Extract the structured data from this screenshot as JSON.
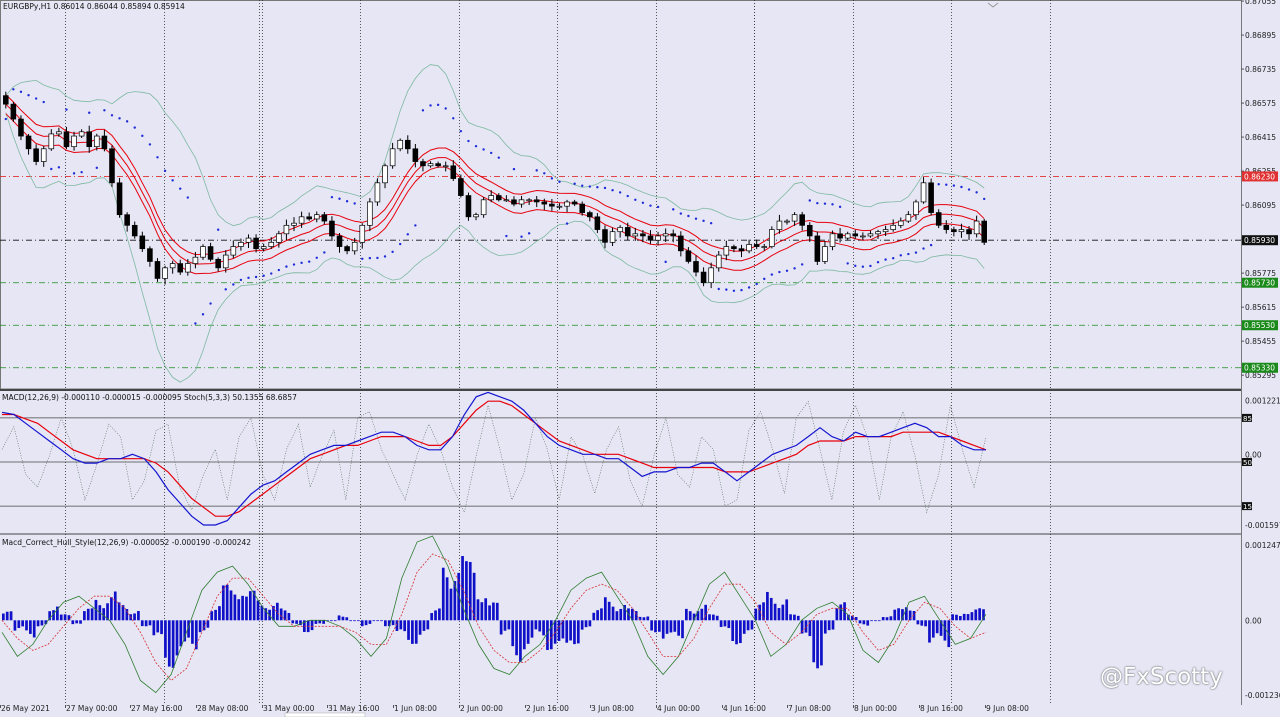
{
  "header": {
    "symbol_line": "EURGBPy,H1  0.86014 0.86044 0.85894 0.85914"
  },
  "subwindow1": {
    "title": "MACD(12,26,9) -0.000110 -0.000015 -0.000095  Stoch(5,3,3) 50.1355 68.6857"
  },
  "subwindow2": {
    "title": "Macd_Correct_Hull_Style(12,26,9) -0.000052 -0.000190 -0.000242"
  },
  "watermark": "@FxScotty",
  "colors": {
    "background": "#e6e6f5",
    "bull_candle": "#ffffff",
    "bear_candle": "#000000",
    "ma": "#e8000b",
    "macd_main": "#1515d0",
    "macd_signal": "#e8000b",
    "histogram": "#1010c8",
    "line_red": "#d83030",
    "line_green": "#2f7d2f",
    "psar": "#1e2bd8"
  },
  "chart_data": [
    {
      "type": "candlestick",
      "title": "EURGBPy,H1",
      "ohlc_header": [
        "0.86014",
        "0.86044",
        "0.85894",
        "0.85914"
      ],
      "x_tick_labels": [
        "26 May 2021",
        "27 May 00:00",
        "27 May 16:00",
        "28 May 08:00",
        "31 May 00:00",
        "31 May 16:00",
        "1 Jun 08:00",
        "2 Jun 00:00",
        "2 Jun 16:00",
        "3 Jun 08:00",
        "4 Jun 00:00",
        "4 Jun 16:00",
        "7 Jun 08:00",
        "8 Jun 00:00",
        "8 Jun 16:00",
        "9 Jun 08:00"
      ],
      "y_ticks": [
        "0.87055",
        "0.86895",
        "0.86735",
        "0.86575",
        "0.86415",
        "0.86255",
        "0.86095",
        "0.85935",
        "0.85775",
        "0.85615",
        "0.85455",
        "0.85295"
      ],
      "ylim": [
        0.8523,
        0.8706
      ],
      "horizontal_levels": [
        {
          "label": "0.86230",
          "value": 0.8623,
          "color": "#e03030"
        },
        {
          "label": "0.85930",
          "value": 0.8593,
          "color": "#111111"
        },
        {
          "label": "0.85730",
          "value": 0.8573,
          "color": "#1a8a1a"
        },
        {
          "label": "0.85530",
          "value": 0.8553,
          "color": "#1a8a1a"
        },
        {
          "label": "0.85330",
          "value": 0.8533,
          "color": "#1a8a1a"
        }
      ],
      "close_series": [
        0.8657,
        0.865,
        0.8642,
        0.8636,
        0.863,
        0.8636,
        0.8643,
        0.8644,
        0.8637,
        0.8642,
        0.8644,
        0.8637,
        0.8642,
        0.8636,
        0.862,
        0.8605,
        0.86,
        0.8595,
        0.8589,
        0.8583,
        0.8575,
        0.858,
        0.8582,
        0.8578,
        0.8582,
        0.8585,
        0.859,
        0.8584,
        0.858,
        0.8586,
        0.859,
        0.8592,
        0.8594,
        0.8589,
        0.859,
        0.8592,
        0.8596,
        0.86,
        0.8601,
        0.8604,
        0.8603,
        0.8605,
        0.8602,
        0.8595,
        0.859,
        0.8588,
        0.8592,
        0.86,
        0.8611,
        0.862,
        0.8628,
        0.8636,
        0.864,
        0.8636,
        0.863,
        0.8628,
        0.8629,
        0.8628,
        0.8628,
        0.8622,
        0.8614,
        0.8604,
        0.8605,
        0.8612,
        0.8614,
        0.8612,
        0.8612,
        0.861,
        0.8612,
        0.8612,
        0.8611,
        0.861,
        0.8609,
        0.8609,
        0.8611,
        0.861,
        0.8606,
        0.8604,
        0.8598,
        0.8592,
        0.8597,
        0.8599,
        0.8595,
        0.8596,
        0.8595,
        0.8593,
        0.8595,
        0.8596,
        0.8595,
        0.8588,
        0.8583,
        0.8578,
        0.8573,
        0.858,
        0.8586,
        0.859,
        0.8589,
        0.8588,
        0.8591,
        0.859,
        0.859,
        0.8598,
        0.8602,
        0.8602,
        0.8605,
        0.86,
        0.8595,
        0.8583,
        0.859,
        0.8596,
        0.8594,
        0.8596,
        0.8595,
        0.8595,
        0.8596,
        0.8597,
        0.8598,
        0.86,
        0.8602,
        0.8605,
        0.8611,
        0.862,
        0.8606,
        0.86,
        0.8598,
        0.8597,
        0.8598,
        0.8596,
        0.8602,
        0.8592
      ]
    },
    {
      "type": "line",
      "title": "MACD(12,26,9) -0.000110 -0.000015 -0.000095  Stoch(5,3,3) 50.1355 68.6857",
      "y_tick_labels": [
        "0.001221",
        "0.00",
        "-0.001597"
      ],
      "stoch_levels": [
        "85",
        "50",
        "15"
      ],
      "series": [
        {
          "name": "MACD",
          "values": [
            0.00095,
            0.0009,
            0.0007,
            0.0005,
            0.0003,
            0.0001,
            -0.0001,
            -0.0002,
            -0.0002,
            -0.0001,
            -0.0001,
            0.0,
            -0.0001,
            -0.0004,
            -0.0008,
            -0.0011,
            -0.0014,
            -0.0016,
            -0.0016,
            -0.0015,
            -0.0012,
            -0.0009,
            -0.0007,
            -0.0006,
            -0.0004,
            -0.0002,
            0.0,
            0.0001,
            0.0002,
            0.0002,
            0.0003,
            0.0004,
            0.0005,
            0.0005,
            0.0004,
            0.0002,
            0.0001,
            0.0001,
            0.0004,
            0.0009,
            0.0013,
            0.0014,
            0.0013,
            0.0012,
            0.001,
            0.0007,
            0.0004,
            0.0002,
            0.0001,
            0.0,
            0.0,
            -0.0001,
            -0.0001,
            -0.0003,
            -0.0005,
            -0.0004,
            -0.0004,
            -0.0003,
            -0.0003,
            -0.0002,
            -0.0002,
            -0.0004,
            -0.0006,
            -0.0004,
            -0.0002,
            0.0,
            0.0001,
            0.0002,
            0.0004,
            0.0006,
            0.0004,
            0.0003,
            0.0005,
            0.0004,
            0.0004,
            0.0005,
            0.0006,
            0.0007,
            0.0006,
            0.0004,
            0.0004,
            0.0002,
            0.0001,
            0.0001
          ]
        },
        {
          "name": "Signal",
          "values": [
            0.0009,
            0.0009,
            0.0008,
            0.0007,
            0.0005,
            0.0003,
            0.0001,
            0.0,
            -0.0001,
            -0.0001,
            -0.0001,
            -0.0001,
            -0.0001,
            -0.0002,
            -0.0004,
            -0.0007,
            -0.001,
            -0.0012,
            -0.0014,
            -0.0014,
            -0.0013,
            -0.0011,
            -0.0009,
            -0.0007,
            -0.0005,
            -0.0003,
            -0.0001,
            0.0,
            0.0001,
            0.0002,
            0.0002,
            0.0003,
            0.0004,
            0.0004,
            0.0004,
            0.0003,
            0.0002,
            0.0002,
            0.0004,
            0.0007,
            0.001,
            0.0012,
            0.0012,
            0.0011,
            0.0009,
            0.0007,
            0.0005,
            0.0003,
            0.0002,
            0.0001,
            0.0,
            0.0,
            0.0,
            -0.0001,
            -0.0002,
            -0.0003,
            -0.0003,
            -0.0003,
            -0.0003,
            -0.0003,
            -0.0003,
            -0.0004,
            -0.0004,
            -0.0004,
            -0.0003,
            -0.0002,
            -0.0001,
            0.0,
            0.0002,
            0.0003,
            0.0003,
            0.0003,
            0.0004,
            0.0004,
            0.0004,
            0.0004,
            0.0005,
            0.0005,
            0.0005,
            0.0005,
            0.0004,
            0.0003,
            0.0002,
            0.0001
          ]
        },
        {
          "name": "Stoch",
          "values": [
            60,
            78,
            40,
            30,
            55,
            85,
            60,
            20,
            48,
            80,
            70,
            20,
            35,
            75,
            80,
            30,
            12,
            40,
            60,
            20,
            70,
            85,
            40,
            20,
            60,
            80,
            30,
            55,
            75,
            20,
            85,
            90,
            60,
            40,
            20,
            55,
            80,
            60,
            30,
            10,
            55,
            95,
            60,
            20,
            40,
            85,
            60,
            20,
            70,
            55,
            25,
            60,
            78,
            35,
            15,
            55,
            85,
            40,
            30,
            70,
            60,
            15,
            20,
            75,
            90,
            60,
            25,
            85,
            98,
            60,
            20,
            75,
            95,
            70,
            20,
            70,
            90,
            55,
            10,
            40,
            95,
            60,
            30,
            70
          ]
        }
      ]
    },
    {
      "type": "bar",
      "title": "Macd_Correct_Hull_Style(12,26,9) -0.000052 -0.000190 -0.000242",
      "y_tick_labels": [
        "0.001247",
        "0.00",
        "-0.001236"
      ],
      "series": [
        {
          "name": "Histogram",
          "values": [
            0.00015,
            -0.0002,
            -0.0003,
            -0.0001,
            0.0003,
            0.0001,
            -0.0001,
            0.0002,
            0.0004,
            0.0005,
            0.0003,
            0.0002,
            -0.0001,
            -0.0004,
            -0.0008,
            -0.0007,
            -0.0005,
            -0.0002,
            0.0003,
            0.0006,
            0.0007,
            0.0005,
            0.0004,
            0.0003,
            0.0002,
            -0.0001,
            -0.0002,
            -0.0001,
            0.0,
            0.0001,
            0.0,
            -0.0001,
            0.0,
            -0.0001,
            -0.0003,
            -0.0004,
            -0.0003,
            0.0002,
            0.0009,
            0.0013,
            0.001,
            0.0006,
            0.0003,
            -0.0003,
            -0.0007,
            -0.0005,
            -0.0003,
            -0.0005,
            -0.0006,
            -0.0004,
            -0.0002,
            0.0002,
            0.0004,
            0.0003,
            0.0002,
            0.0001,
            -0.0002,
            -0.0004,
            -0.0003,
            0.0002,
            0.0003,
            0.0001,
            -0.0002,
            -0.0004,
            -0.0003,
            0.0003,
            0.0005,
            0.0004,
            0.0001,
            -0.0004,
            -0.0008,
            -0.0003,
            0.0003,
            0.0001,
            -0.0001,
            0.0,
            0.0001,
            0.0002,
            0.0003,
            -0.0001,
            -0.0004,
            -0.0005,
            0.0001,
            0.0002,
            0.0002
          ]
        },
        {
          "name": "Line 1",
          "values": [
            -0.0002,
            -0.0006,
            -0.0004,
            0.0,
            0.0003,
            0.0004,
            0.0002,
            0.0,
            -0.0004,
            -0.001,
            -0.0012,
            -0.0009,
            -0.0002,
            0.0005,
            0.0008,
            0.0009,
            0.0006,
            0.0002,
            -0.0001,
            -0.0001,
            0.0,
            0.0,
            -0.0001,
            -0.0003,
            -0.0006,
            -0.0003,
            0.0007,
            0.0013,
            0.0014,
            0.0009,
            0.0002,
            -0.0004,
            -0.0008,
            -0.0009,
            -0.0006,
            -0.0004,
            0.0,
            0.0005,
            0.0007,
            0.0008,
            0.0004,
            0.0,
            -0.0006,
            -0.0009,
            -0.0006,
            0.0,
            0.0006,
            0.0008,
            0.0004,
            0.0,
            -0.0006,
            -0.0004,
            0.0,
            0.0002,
            0.0003,
            0.0001,
            -0.0005,
            -0.0007,
            -0.0003,
            0.0003,
            0.0004,
            0.0,
            -0.0004,
            -0.0003,
            0.0001
          ]
        },
        {
          "name": "Line 2",
          "values": [
            0.0,
            -0.0003,
            -0.0005,
            -0.0004,
            -0.0001,
            0.0002,
            0.0004,
            0.0004,
            0.0002,
            -0.0002,
            -0.0007,
            -0.001,
            -0.0008,
            -0.0002,
            0.0004,
            0.0007,
            0.0007,
            0.0004,
            0.0001,
            -0.0001,
            -0.0001,
            -0.0001,
            -0.0001,
            -0.0002,
            -0.0004,
            -0.0004,
            0.0001,
            0.0008,
            0.0011,
            0.001,
            0.0005,
            -0.0001,
            -0.0005,
            -0.0007,
            -0.0007,
            -0.0005,
            -0.0002,
            0.0002,
            0.0005,
            0.0006,
            0.0005,
            0.0002,
            -0.0002,
            -0.0006,
            -0.0006,
            -0.0003,
            0.0002,
            0.0006,
            0.0006,
            0.0003,
            -0.0002,
            -0.0004,
            -0.0002,
            0.0001,
            0.0002,
            0.0002,
            -0.0002,
            -0.0005,
            -0.0004,
            0.0,
            0.0003,
            0.0002,
            -0.0001,
            -0.0003,
            -0.0002
          ]
        }
      ]
    }
  ]
}
